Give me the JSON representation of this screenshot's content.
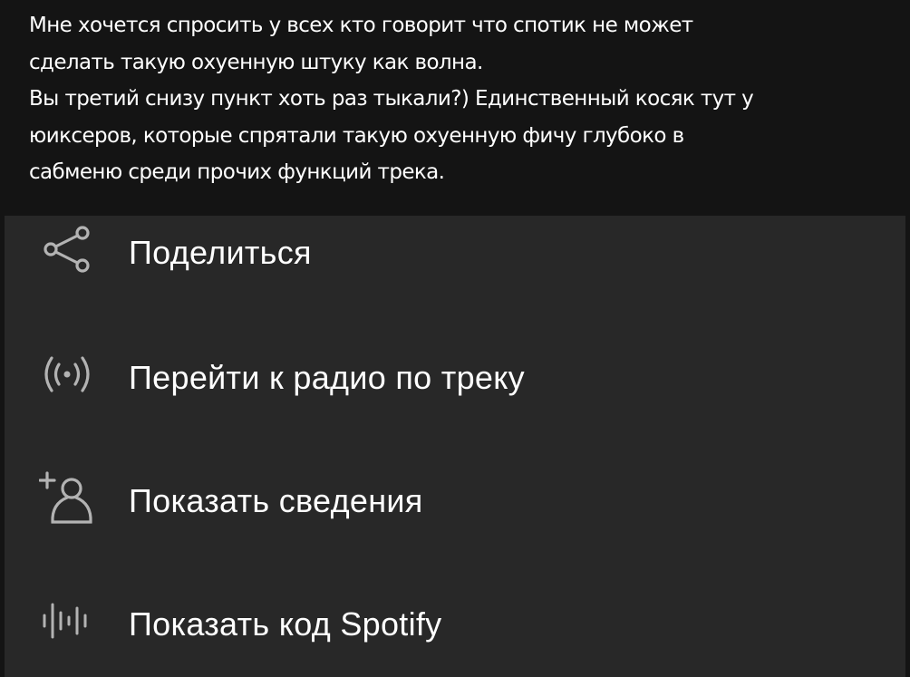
{
  "comment": {
    "lines": [
      "Мне хочется спросить у всех кто говорит что спотик не может",
      "сделать такую охуенную штуку как волна.",
      "Вы третий снизу пункт хоть раз тыкали?) Единственный косяк тут у",
      "юиксеров, которые спрятали такую охуенную фичу глубоко в",
      "сабменю среди прочих функций трека."
    ]
  },
  "menu": {
    "items": [
      {
        "label": "Поделиться",
        "icon": "share-icon"
      },
      {
        "label": "Перейти к радио по треку",
        "icon": "radio-icon"
      },
      {
        "label": "Показать сведения",
        "icon": "add-person-icon"
      },
      {
        "label": "Показать код Spotify",
        "icon": "spotify-code-icon"
      }
    ]
  },
  "colors": {
    "comment_background": "#141414",
    "menu_background": "#282828",
    "text": "#ffffff",
    "icon": "#b3b3b3"
  }
}
